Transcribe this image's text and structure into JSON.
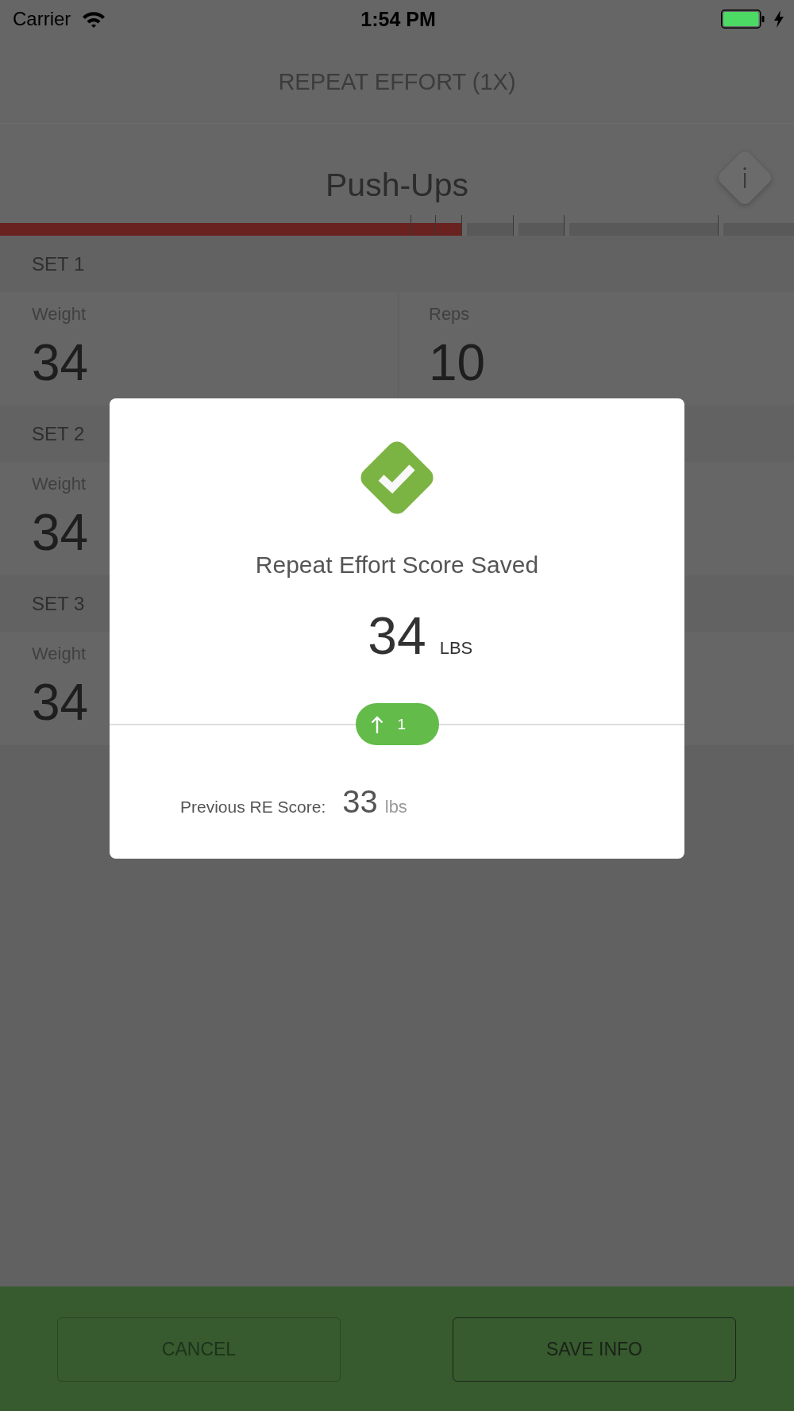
{
  "status_bar": {
    "carrier": "Carrier",
    "time": "1:54 PM"
  },
  "header": {
    "title": "REPEAT EFFORT (1X)"
  },
  "exercise": {
    "name": "Push-Ups"
  },
  "progress": {
    "level": 0.581
  },
  "sets": [
    {
      "title": "SET 1",
      "fields": [
        {
          "label": "Weight",
          "value": "34"
        },
        {
          "label": "Reps",
          "value": "10"
        }
      ]
    },
    {
      "title": "SET 2",
      "fields": [
        {
          "label": "Weight",
          "value": "34"
        }
      ]
    },
    {
      "title": "SET 3",
      "fields": [
        {
          "label": "Weight",
          "value": "34"
        }
      ]
    }
  ],
  "dialog": {
    "title": "Repeat Effort Score Saved",
    "score": "34",
    "unit": "LBS",
    "change": {
      "kind": "up",
      "value": "1"
    },
    "previous": {
      "label": "Previous RE Score:",
      "value": "33",
      "unit": "lbs"
    }
  },
  "buttons": [
    {
      "label": "CANCEL",
      "disabled": true
    },
    {
      "label": "SAVE INFO",
      "disabled": false
    }
  ]
}
